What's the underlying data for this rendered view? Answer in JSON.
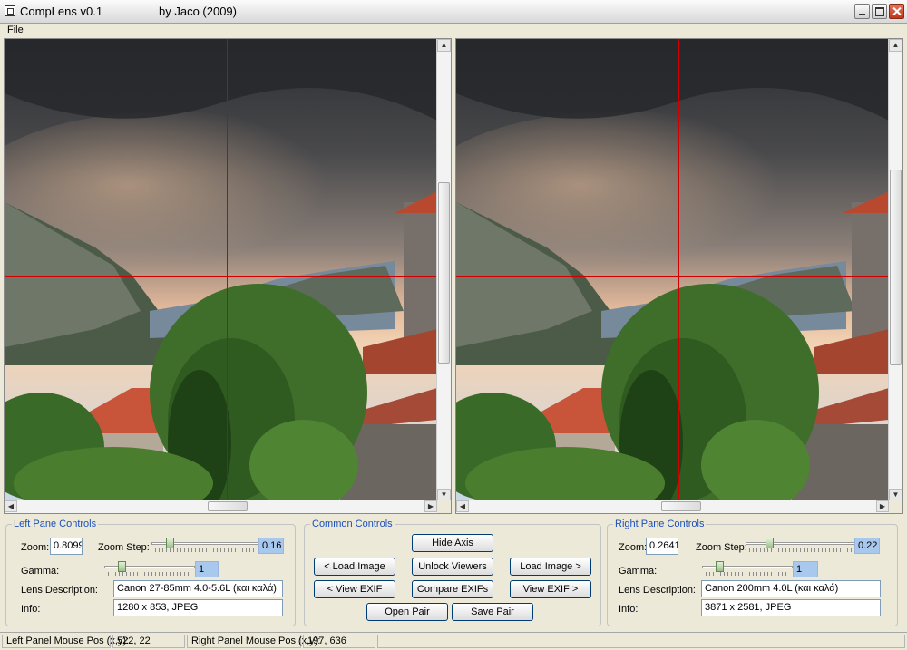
{
  "window": {
    "title": "CompLens v0.1",
    "author": "by Jaco (2009)"
  },
  "menu": {
    "file": "File"
  },
  "left_pane_controls": {
    "title": "Left Pane Controls",
    "zoom_label": "Zoom:",
    "zoom_value": "0.80999",
    "zoom_step_label": "Zoom Step:",
    "zoom_step_value": "0.16",
    "gamma_label": "Gamma:",
    "gamma_value": "1",
    "lens_label": "Lens Description:",
    "lens_value": "Canon 27-85mm 4.0-5.6L (και καλά)",
    "info_label": "Info:",
    "info_value": "1280 x 853, JPEG"
  },
  "common_controls": {
    "title": "Common Controls",
    "hide_axis": "Hide Axis",
    "load_left": "< Load Image",
    "unlock_viewers": "Unlock Viewers",
    "load_right": "Load Image >",
    "view_exif_left": "< View EXIF",
    "compare_exifs": "Compare EXIFs",
    "view_exif_right": "View EXIF >",
    "open_pair": "Open Pair",
    "save_pair": "Save Pair"
  },
  "right_pane_controls": {
    "title": "Right Pane Controls",
    "zoom_label": "Zoom:",
    "zoom_value": "0.26413",
    "zoom_step_label": "Zoom Step:",
    "zoom_step_value": "0.22",
    "gamma_label": "Gamma:",
    "gamma_value": "1",
    "lens_label": "Lens Description:",
    "lens_value": "Canon 200mm 4.0L (και καλά)",
    "info_label": "Info:",
    "info_value": "3871 x 2581, JPEG"
  },
  "status": {
    "left_label": "Left Panel Mouse Pos (x,y):",
    "left_value": "522, 22",
    "right_label": "Right Panel Mouse Pos (x,y):",
    "right_value": "197, 636"
  },
  "icons": [
    "app-icon",
    "minimize-icon",
    "maximize-icon",
    "close-icon",
    "arrow-up-icon",
    "arrow-down-icon",
    "arrow-left-icon",
    "arrow-right-icon"
  ],
  "colors": {
    "crosshair": "#d00000",
    "group_title": "#1c4fb9",
    "slider_value_bg": "#a8c8ee"
  }
}
